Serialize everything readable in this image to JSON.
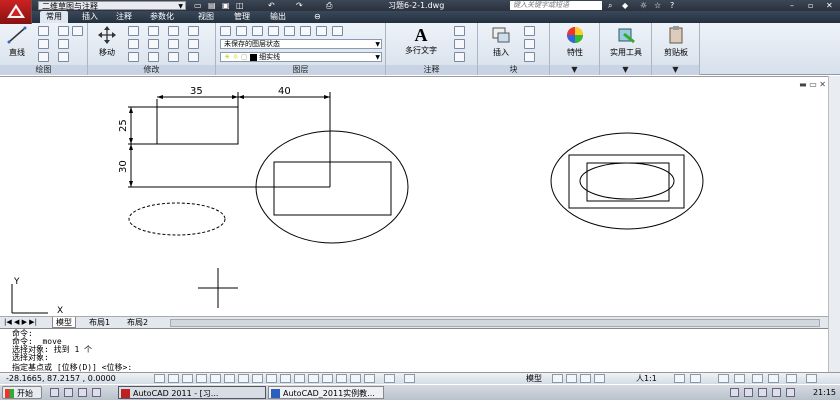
{
  "titlebar": {
    "workspace": "二维草图与注释",
    "document_title": "习题6-2-1.dwg",
    "search_placeholder": "键入关键字或短语"
  },
  "tabs": [
    "常用",
    "插入",
    "注释",
    "参数化",
    "视图",
    "管理",
    "输出"
  ],
  "ribbon": {
    "draw": {
      "title": "绘图",
      "line_label": "直线"
    },
    "modify": {
      "title": "修改",
      "move_label": "移动"
    },
    "layers": {
      "title": "图层",
      "layer_state": "未保存的图层状态",
      "linetype": "细实线"
    },
    "annotation": {
      "title": "注释",
      "mtext_label": "多行文字"
    },
    "block": {
      "title": "块",
      "insert_label": "插入"
    },
    "properties": {
      "title": "特性",
      "label": "特性"
    },
    "utilities": {
      "title": "实用工具",
      "label": "实用工具"
    },
    "clipboard": {
      "title": "剪贴板",
      "label": "剪贴板"
    }
  },
  "drawing": {
    "dim_width": "35",
    "dim_offset": "40",
    "dim_height": "25",
    "dim_vertical": "30",
    "ucs_x": "X",
    "ucs_y": "Y"
  },
  "layout_tabs": [
    "模型",
    "布局1",
    "布局2"
  ],
  "command_line": {
    "history": [
      "命令:",
      "命令:  _move",
      "选择对象: 找到 1 个",
      "选择对象:"
    ],
    "prompt": "指定基点或 [位移(D)] <位移>:"
  },
  "statusbar": {
    "coordinates": "-28.1665, 87.2157 , 0.0000",
    "model_label": "模型",
    "scale_label": "人1:1"
  },
  "taskbar": {
    "start_label": "开始",
    "tasks": [
      "AutoCAD 2011 - [习...",
      "AutoCAD_2011实例教..."
    ],
    "clock": "21:15"
  }
}
